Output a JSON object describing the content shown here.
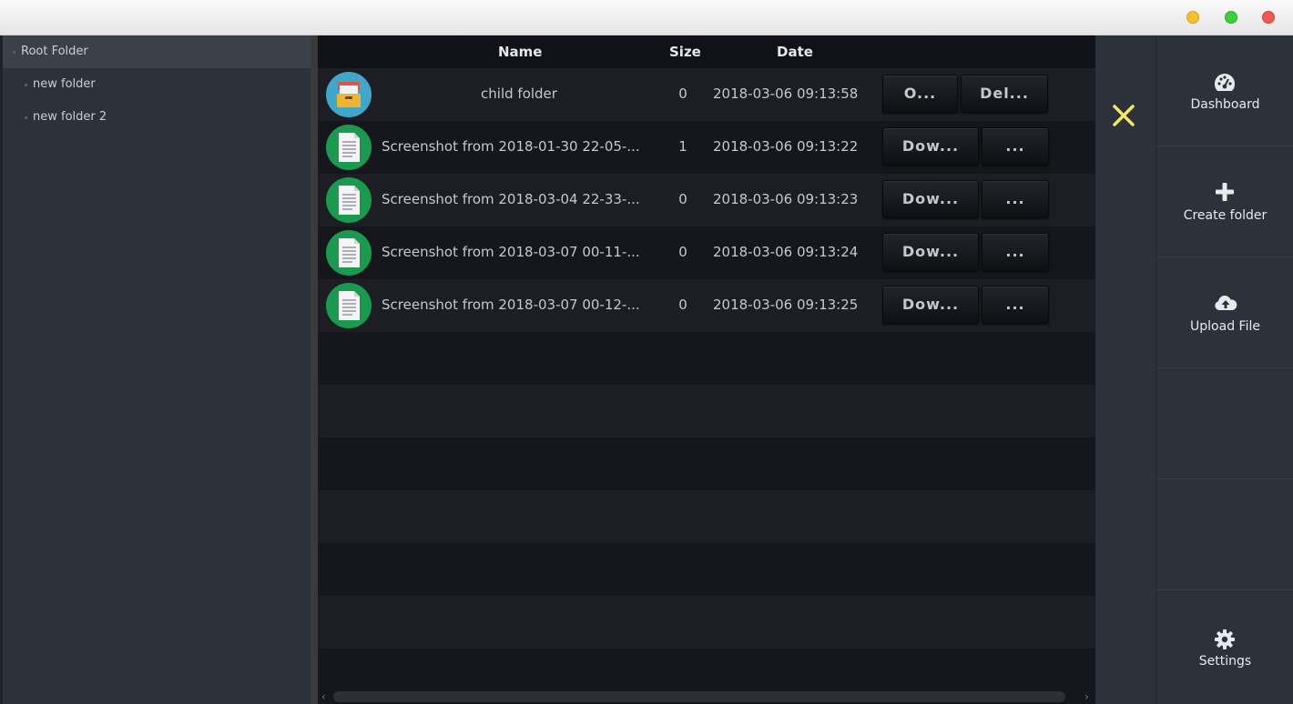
{
  "window": {
    "controls": [
      "minimize",
      "maximize",
      "close"
    ]
  },
  "tree": {
    "items": [
      {
        "label": "Root Folder",
        "level": 0
      },
      {
        "label": "new folder",
        "level": 1
      },
      {
        "label": "new folder 2",
        "level": 1
      }
    ]
  },
  "table": {
    "headers": {
      "name": "Name",
      "size": "Size",
      "date": "Date"
    },
    "rows": [
      {
        "type": "folder",
        "icon": "folder-icon",
        "name": "child folder",
        "size": "0",
        "date": "2018-03-06 09:13:58",
        "actions": [
          "O...",
          "Del..."
        ]
      },
      {
        "type": "file",
        "icon": "file-icon",
        "name": "Screenshot from 2018-01-30 22-05-...",
        "size": "1",
        "date": "2018-03-06 09:13:22",
        "actions": [
          "Dow...",
          "..."
        ]
      },
      {
        "type": "file",
        "icon": "file-icon",
        "name": "Screenshot from 2018-03-04 22-33-...",
        "size": "0",
        "date": "2018-03-06 09:13:23",
        "actions": [
          "Dow...",
          "..."
        ]
      },
      {
        "type": "file",
        "icon": "file-icon",
        "name": "Screenshot from 2018-03-07 00-11-...",
        "size": "0",
        "date": "2018-03-06 09:13:24",
        "actions": [
          "Dow...",
          "..."
        ]
      },
      {
        "type": "file",
        "icon": "file-icon",
        "name": "Screenshot from 2018-03-07 00-12-...",
        "size": "0",
        "date": "2018-03-06 09:13:25",
        "actions": [
          "Dow...",
          "..."
        ]
      }
    ],
    "scroll_arrows": {
      "left": "‹",
      "right": "›"
    }
  },
  "close_panel": {
    "icon": "close-icon",
    "color": "#f2ea5e"
  },
  "nav": {
    "dashboard": {
      "label": "Dashboard",
      "icon": "dashboard-icon"
    },
    "create_folder": {
      "label": "Create folder",
      "icon": "plus-icon"
    },
    "upload_file": {
      "label": "Upload File",
      "icon": "cloud-upload-icon"
    },
    "settings": {
      "label": "Settings",
      "icon": "gear-icon"
    }
  },
  "colors": {
    "accent_close": "#f2ea5e",
    "folder_icon_bg": "#3fa7c9",
    "file_icon_bg": "#1a9a4e"
  }
}
